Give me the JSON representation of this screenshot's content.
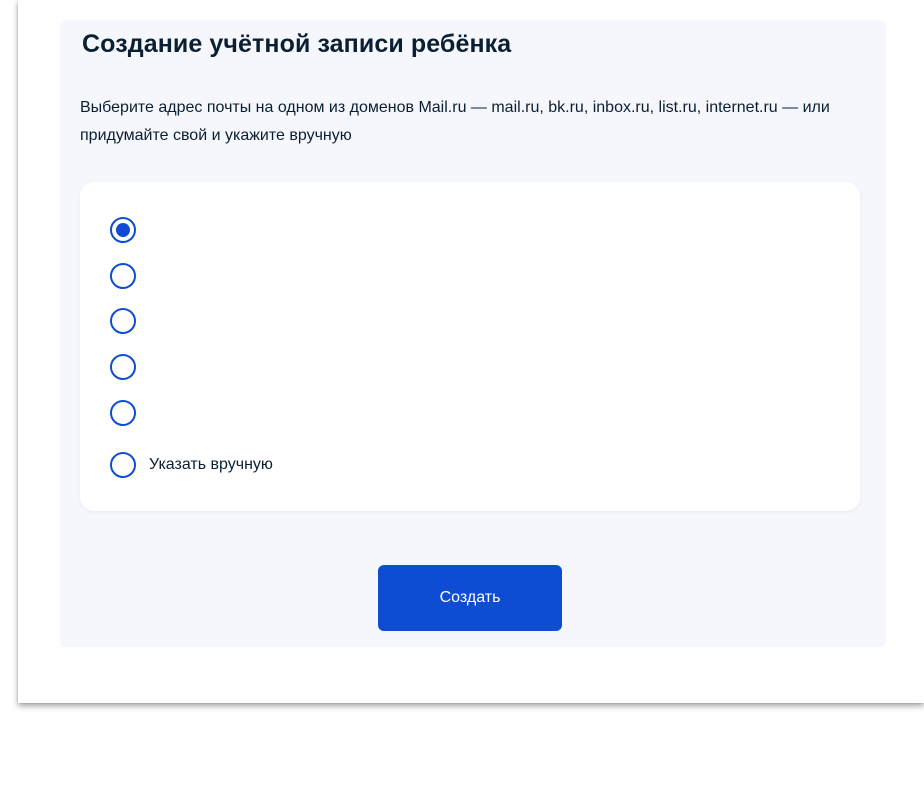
{
  "form": {
    "title": "Создание учётной записи ребёнка",
    "description": "Выберите адрес почты на одном из доменов Mail.ru — mail.ru, bk.ru, inbox.ru, list.ru, internet.ru — или придумайте свой и укажите вручную",
    "options": [
      {
        "label": "",
        "checked": true
      },
      {
        "label": "",
        "checked": false
      },
      {
        "label": "",
        "checked": false
      },
      {
        "label": "",
        "checked": false
      },
      {
        "label": "",
        "checked": false
      },
      {
        "label": "Указать вручную",
        "checked": false
      }
    ],
    "submit_label": "Создать"
  },
  "colors": {
    "accent": "#0d4cd3",
    "text": "#0b1f33",
    "panel_background": "#f5f7fc",
    "card_background": "#ffffff"
  }
}
